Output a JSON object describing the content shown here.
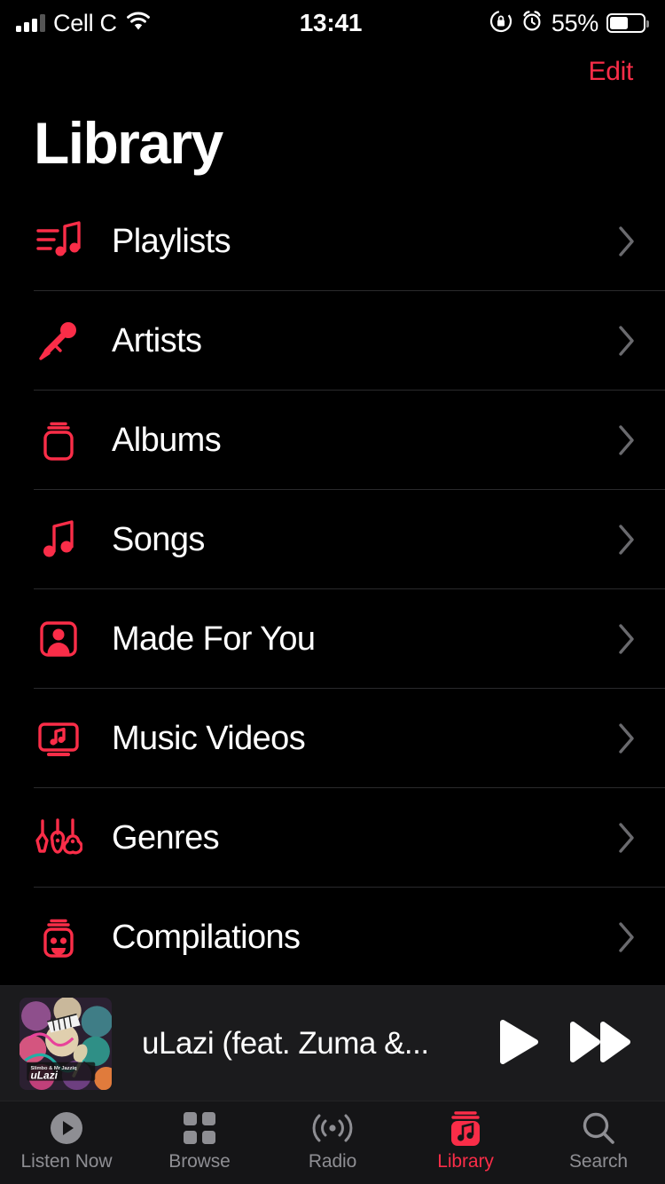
{
  "theme": {
    "accent": "#fa2d48",
    "background": "#000000",
    "miniplayer_bg": "#1b1b1d",
    "tabbar_bg": "#151517",
    "separator": "#2a2a2c",
    "text_primary": "#ffffff",
    "text_muted": "#8e8e93"
  },
  "status_bar": {
    "carrier": "Cell C",
    "signal_icon": "cellular-bars-icon",
    "wifi_icon": "wifi-icon",
    "time": "13:41",
    "rotation_lock_icon": "rotation-lock-icon",
    "alarm_icon": "alarm-clock-icon",
    "battery_percent": "55%",
    "battery_level": 55,
    "battery_icon": "battery-icon"
  },
  "header": {
    "edit_label": "Edit",
    "title": "Library"
  },
  "library_rows": [
    {
      "label": "Playlists",
      "icon": "playlists-icon",
      "chevron": "chevron-right-icon"
    },
    {
      "label": "Artists",
      "icon": "microphone-icon",
      "chevron": "chevron-right-icon"
    },
    {
      "label": "Albums",
      "icon": "albums-icon",
      "chevron": "chevron-right-icon"
    },
    {
      "label": "Songs",
      "icon": "music-note-icon",
      "chevron": "chevron-right-icon"
    },
    {
      "label": "Made For You",
      "icon": "person-square-icon",
      "chevron": "chevron-right-icon"
    },
    {
      "label": "Music Videos",
      "icon": "tv-music-icon",
      "chevron": "chevron-right-icon"
    },
    {
      "label": "Genres",
      "icon": "guitars-icon",
      "chevron": "chevron-right-icon"
    },
    {
      "label": "Compilations",
      "icon": "compilations-icon",
      "chevron": "chevron-right-icon"
    }
  ],
  "mini_player": {
    "artwork_label": "uLazi",
    "artwork_icon": "album-artwork",
    "track_title": "uLazi (feat. Zuma &...",
    "play_label": "play-button",
    "play_icon": "play-icon",
    "forward_label": "fast-forward-button",
    "forward_icon": "fast-forward-icon"
  },
  "tabs": [
    {
      "label": "Listen Now",
      "icon": "play-circle-icon",
      "active": false
    },
    {
      "label": "Browse",
      "icon": "grid-icon",
      "active": false
    },
    {
      "label": "Radio",
      "icon": "broadcast-icon",
      "active": false
    },
    {
      "label": "Library",
      "icon": "library-icon",
      "active": true
    },
    {
      "label": "Search",
      "icon": "search-icon",
      "active": false
    }
  ]
}
